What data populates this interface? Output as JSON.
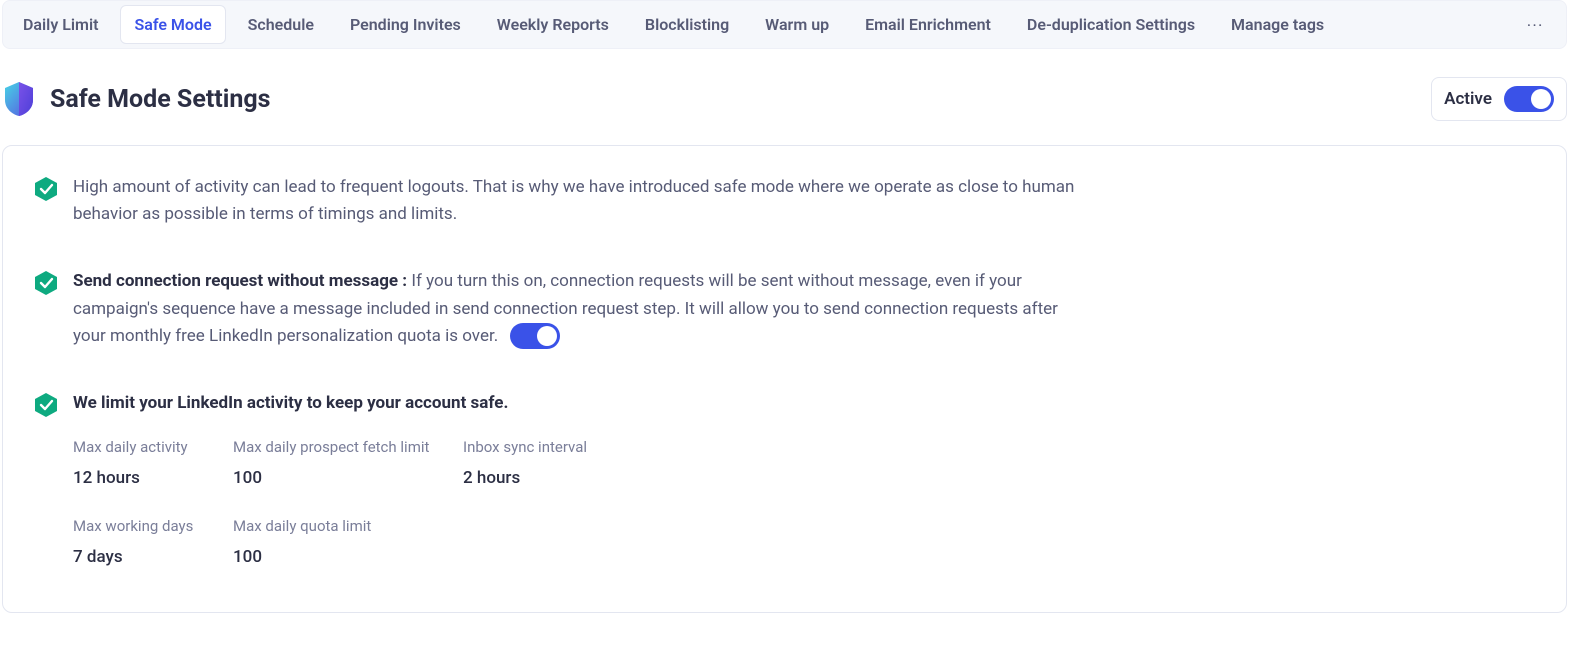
{
  "tabs": [
    {
      "label": "Daily Limit"
    },
    {
      "label": "Safe Mode"
    },
    {
      "label": "Schedule"
    },
    {
      "label": "Pending Invites"
    },
    {
      "label": "Weekly Reports"
    },
    {
      "label": "Blocklisting"
    },
    {
      "label": "Warm up"
    },
    {
      "label": "Email Enrichment"
    },
    {
      "label": "De-duplication Settings"
    },
    {
      "label": "Manage tags"
    }
  ],
  "active_tab_index": 1,
  "header": {
    "title": "Safe Mode Settings",
    "active_label": "Active",
    "active_on": true
  },
  "items": {
    "intro": {
      "text": "High amount of activity can lead to frequent logouts. That is why we have introduced safe mode where we operate as close to human behavior as possible in terms of timings and limits."
    },
    "no_message": {
      "bold": "Send connection request without message : ",
      "text": "If you turn this on, connection requests will be sent without message, even if your campaign's sequence have a message included in send connection request step. It will allow you to send connection requests after your monthly free LinkedIn personalization quota is over.",
      "toggle_on": true
    },
    "limits_heading": "We limit your LinkedIn activity to keep your account safe."
  },
  "limits": {
    "max_daily_activity": {
      "label": "Max daily activity",
      "value": "12 hours"
    },
    "max_daily_prospect_fetch": {
      "label": "Max daily prospect fetch limit",
      "value": "100"
    },
    "inbox_sync_interval": {
      "label": "Inbox sync interval",
      "value": "2 hours"
    },
    "max_working_days": {
      "label": "Max working days",
      "value": "7 days"
    },
    "max_daily_quota_limit": {
      "label": "Max daily quota limit",
      "value": "100"
    }
  },
  "icons": {
    "shield": "shield-icon",
    "hex_check": "hex-check-icon",
    "more": "···"
  }
}
